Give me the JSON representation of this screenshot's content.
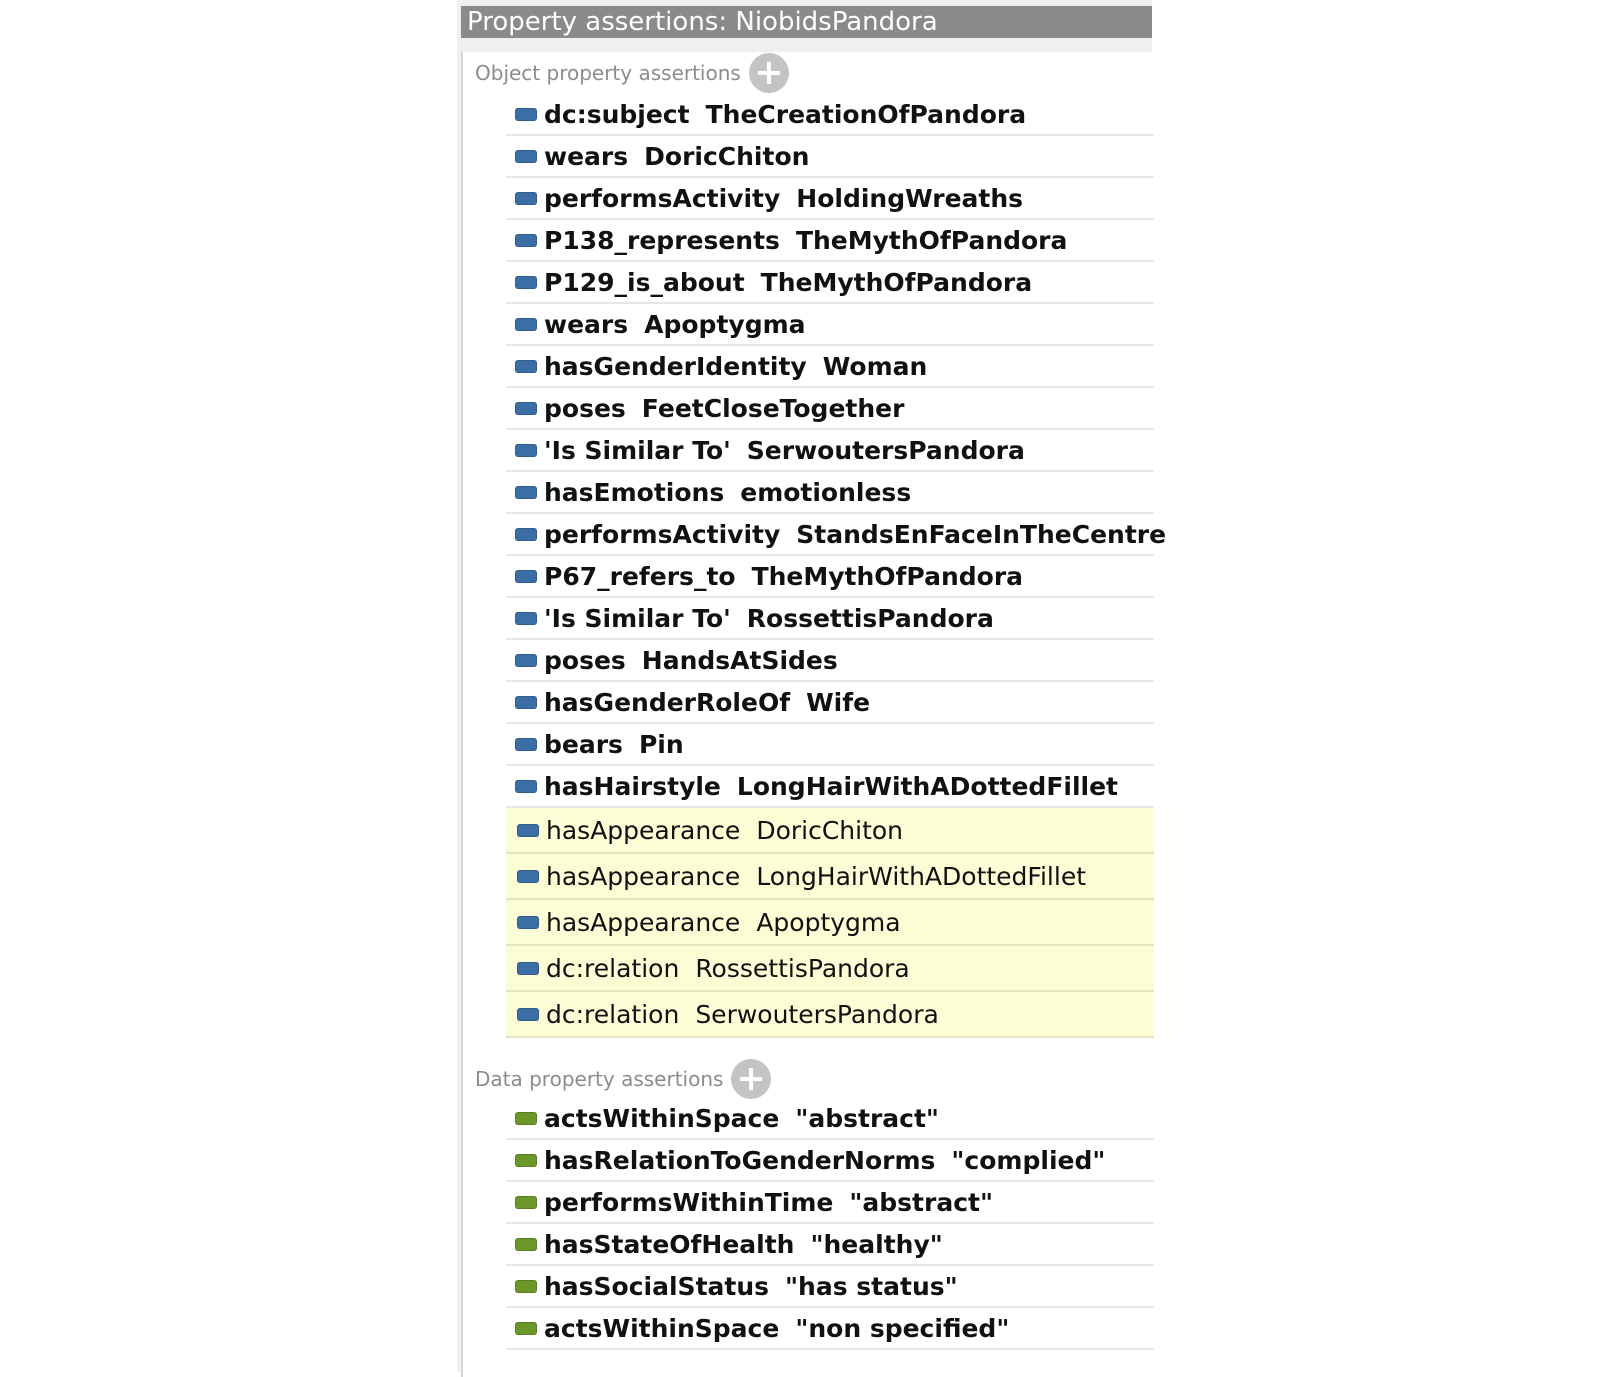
{
  "title": "Property assertions: NiobidsPandora",
  "colors": {
    "object_property_icon": "#3a6ea5",
    "data_property_icon": "#6a962a",
    "inferred_row_background": "#fdfdd5",
    "title_bar": "#8a8a8a"
  },
  "object_section": {
    "label": "Object property assertions",
    "add_icon": "add-circle-icon",
    "rows": [
      {
        "property": "dc:subject",
        "value": "TheCreationOfPandora",
        "inferred": false
      },
      {
        "property": "wears",
        "value": "DoricChiton",
        "inferred": false
      },
      {
        "property": "performsActivity",
        "value": "HoldingWreaths",
        "inferred": false
      },
      {
        "property": "P138_represents",
        "value": "TheMythOfPandora",
        "inferred": false
      },
      {
        "property": "P129_is_about",
        "value": "TheMythOfPandora",
        "inferred": false
      },
      {
        "property": "wears",
        "value": "Apoptygma",
        "inferred": false
      },
      {
        "property": "hasGenderIdentity",
        "value": "Woman",
        "inferred": false
      },
      {
        "property": "poses",
        "value": "FeetCloseTogether",
        "inferred": false
      },
      {
        "property": "'Is Similar To'",
        "value": "SerwoutersPandora",
        "inferred": false
      },
      {
        "property": "hasEmotions",
        "value": "emotionless",
        "inferred": false
      },
      {
        "property": "performsActivity",
        "value": "StandsEnFaceInTheCentre",
        "inferred": false
      },
      {
        "property": "P67_refers_to",
        "value": "TheMythOfPandora",
        "inferred": false
      },
      {
        "property": "'Is Similar To'",
        "value": "RossettisPandora",
        "inferred": false
      },
      {
        "property": "poses",
        "value": "HandsAtSides",
        "inferred": false
      },
      {
        "property": "hasGenderRoleOf",
        "value": "Wife",
        "inferred": false
      },
      {
        "property": "bears",
        "value": "Pin",
        "inferred": false
      },
      {
        "property": "hasHairstyle",
        "value": "LongHairWithADottedFillet",
        "inferred": false
      },
      {
        "property": "hasAppearance",
        "value": "DoricChiton",
        "inferred": true
      },
      {
        "property": "hasAppearance",
        "value": "LongHairWithADottedFillet",
        "inferred": true
      },
      {
        "property": "hasAppearance",
        "value": "Apoptygma",
        "inferred": true
      },
      {
        "property": "dc:relation",
        "value": "RossettisPandora",
        "inferred": true
      },
      {
        "property": "dc:relation",
        "value": "SerwoutersPandora",
        "inferred": true
      }
    ]
  },
  "data_section": {
    "label": "Data property assertions",
    "add_icon": "add-circle-icon",
    "rows": [
      {
        "property": "actsWithinSpace",
        "value": "\"abstract\"",
        "inferred": false
      },
      {
        "property": "hasRelationToGenderNorms",
        "value": "\"complied\"",
        "inferred": false
      },
      {
        "property": "performsWithinTime",
        "value": "\"abstract\"",
        "inferred": false
      },
      {
        "property": "hasStateOfHealth",
        "value": "\"healthy\"",
        "inferred": false
      },
      {
        "property": "hasSocialStatus",
        "value": "\"has status\"",
        "inferred": false
      },
      {
        "property": "actsWithinSpace",
        "value": "\"non specified\"",
        "inferred": false
      }
    ]
  }
}
